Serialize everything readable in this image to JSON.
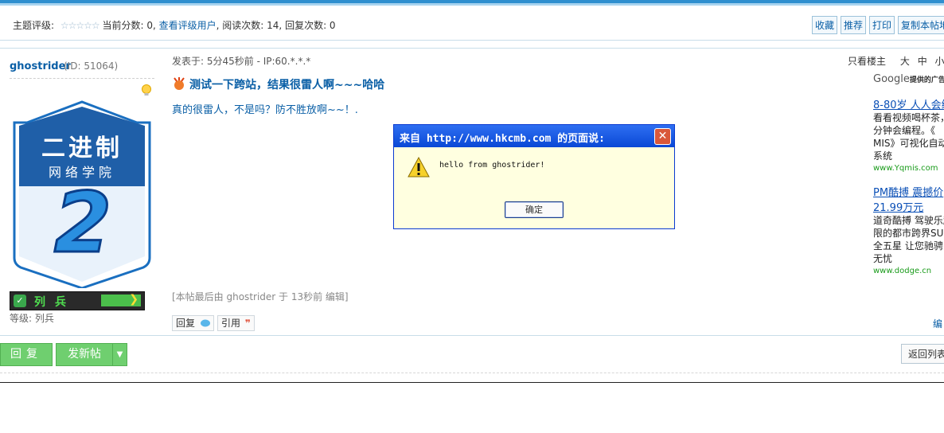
{
  "rating_bar": {
    "topic_rating_label": "主题评级:",
    "stars": "☆☆☆☆☆",
    "current_score_label": "当前分数: 0,",
    "view_raters_link": "查看评级用户",
    "read_count": ", 阅读次数: 14,",
    "reply_count": "回复次数: 0",
    "buttons": [
      "收藏",
      "推荐",
      "打印",
      "复制本帖地"
    ]
  },
  "user": {
    "name": "ghostrider",
    "id_text": "(ID: 51064)",
    "avatar_line1": "二进制",
    "avatar_line2": "网络学院",
    "avatar_number": "2",
    "rank_label": "列兵",
    "level_text": "等级: 列兵"
  },
  "post": {
    "meta": "发表于: 5分45秒前 - IP:60.*.*.*",
    "only_author": "只看楼主",
    "font_sizes": [
      "大",
      "中",
      "小"
    ],
    "title": "测试一下跨站，结果很雷人啊~~~哈哈",
    "body": "真的很雷人，不是吗？防不胜放啊~~！.",
    "edited_note": "[本帖最后由 ghostrider 于 13秒前 编辑]",
    "reply_label": "回复",
    "quote_label": "引用"
  },
  "ads": {
    "provider": "Google",
    "provider_suffix": "提供的广告",
    "items": [
      {
        "title": "8-80岁 人人会编",
        "lines": [
          "看看视频喝杯茶，",
          "分钟会编程。《",
          "MIS》可视化自动",
          "系统"
        ],
        "url": "www.Yqmis.com"
      },
      {
        "title": "PM酷搏 震撼价",
        "title2": "21.99万元",
        "lines": [
          "道奇酷搏 驾驶乐趣",
          "限的都市跨界SU",
          "全五星 让您驰骋",
          "无忧"
        ],
        "url": "www.dodge.cn"
      }
    ],
    "edit_link": "编"
  },
  "actions": {
    "reply": "回复",
    "new_post": "发新帖",
    "back_to_list": "返回列表"
  },
  "dialog": {
    "title": "来自 http://www.hkcmb.com 的页面说:",
    "message": "hello from ghostrider!",
    "ok": "确定",
    "close_symbol": "✕"
  },
  "colors": {
    "link": "#0a5fa6",
    "accent_green": "#6fcf6f",
    "dialog_title": "#0a48d6",
    "dialog_bg": "#ffffe0"
  }
}
